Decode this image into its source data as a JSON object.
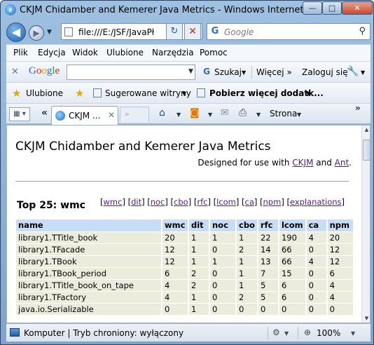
{
  "window": {
    "title": "CKJM Chidamber and Kemerer Java Metrics - Windows Internet Explorer",
    "min_label": "—",
    "max_label": "□",
    "close_label": "✕"
  },
  "nav": {
    "address": "file:///E:/JSF/JavaPł",
    "search_placeholder": "Google"
  },
  "menu": [
    "Plik",
    "Edycja",
    "Widok",
    "Ulubione",
    "Narzędzia",
    "Pomoc"
  ],
  "google_toolbar": {
    "logo": [
      "G",
      "o",
      "o",
      "g",
      "l",
      "e"
    ],
    "search_label": "Szukaj",
    "more_label": "Więcej »",
    "login_label": "Zaloguj się"
  },
  "favorites": {
    "favorites_label": "Ulubione",
    "suggested_label": "Sugerowane witryny",
    "more_addons_label": "Pobierz więcej dodatk..."
  },
  "tabs": {
    "active_title": "CKJM ...",
    "page_label": "Strona"
  },
  "page": {
    "title": "CKJM Chidamber and Kemerer Java Metrics",
    "designed_prefix": "Designed for use with ",
    "designed_link1": "CKJM",
    "designed_mid": " and ",
    "designed_link2": "Ant",
    "designed_suffix": ".",
    "section_title": "Top 25: wmc",
    "links": [
      "wmc",
      "dit",
      "noc",
      "cbo",
      "rfc",
      "lcom",
      "ca",
      "npm",
      "explanations"
    ],
    "table_headers": [
      "name",
      "wmc",
      "dit",
      "noc",
      "cbo",
      "rfc",
      "lcom",
      "ca",
      "npm"
    ],
    "rows": [
      [
        "library1.TTitle_book",
        "20",
        "1",
        "1",
        "1",
        "22",
        "190",
        "4",
        "20"
      ],
      [
        "library1.TFacade",
        "12",
        "1",
        "0",
        "2",
        "14",
        "66",
        "0",
        "12"
      ],
      [
        "library1.TBook",
        "12",
        "1",
        "1",
        "1",
        "13",
        "66",
        "4",
        "12"
      ],
      [
        "library1.TBook_period",
        "6",
        "2",
        "0",
        "1",
        "7",
        "15",
        "0",
        "6"
      ],
      [
        "library1.TTitle_book_on_tape",
        "4",
        "2",
        "0",
        "1",
        "5",
        "6",
        "0",
        "4"
      ],
      [
        "library1.TFactory",
        "4",
        "1",
        "0",
        "2",
        "5",
        "6",
        "0",
        "4"
      ],
      [
        "java.io.Serializable",
        "0",
        "1",
        "0",
        "0",
        "0",
        "0",
        "0",
        "0"
      ]
    ]
  },
  "status": {
    "zone_text": "Komputer | Tryb chroniony: wyłączony",
    "zoom": "100%"
  },
  "colors": {
    "header_bg": "#c7dcf5",
    "row_bg": "#ececdc",
    "link_visited": "#551a8b",
    "chrome_blue": "#7fa3cb"
  }
}
